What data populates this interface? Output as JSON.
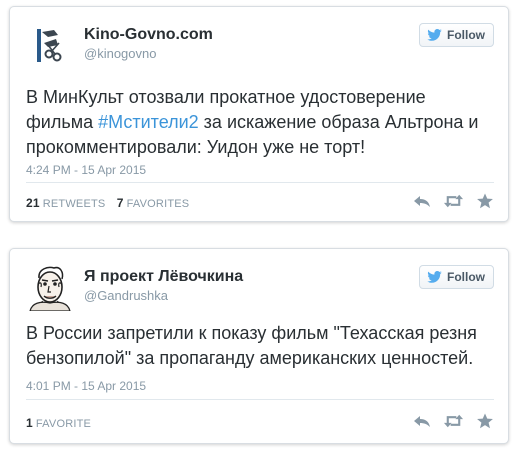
{
  "tweets": [
    {
      "display_name": "Kino-Govno.com",
      "screen_name": "@kinogovno",
      "follow_label": "Follow",
      "text_before": "В МинКульт отозвали прокатное удостоверение фильма ",
      "hashtag": "#Мстители2",
      "text_after": " за искажение образа Альтрона и прокомментировали: Уидон уже не торт!",
      "timestamp": "4:24 PM - 15 Apr 2015",
      "retweets_count": "21",
      "retweets_label": "RETWEETS",
      "favorites_count": "7",
      "favorites_label": "FAVORITES"
    },
    {
      "display_name": "Я проект Лёвочкина",
      "screen_name": "@Gandrushka",
      "follow_label": "Follow",
      "text": "В России запретили к показу фильм \"Техасская резня бензопилой\" за пропаганду американских ценностей.",
      "timestamp": "4:01 PM - 15 Apr 2015",
      "favorites_count": "1",
      "favorites_label": "FAVORITE"
    }
  ],
  "colors": {
    "link": "#3b94d9",
    "muted": "#8899a6",
    "text": "#292f33",
    "bird": "#55acee"
  }
}
